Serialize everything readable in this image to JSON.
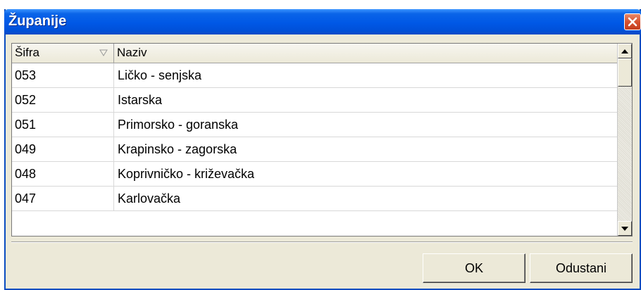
{
  "window": {
    "title": "Županije"
  },
  "grid": {
    "columns": [
      {
        "label": "Šifra"
      },
      {
        "label": "Naziv"
      }
    ],
    "rows": [
      {
        "sifra": "053",
        "naziv": "Ličko - senjska"
      },
      {
        "sifra": "052",
        "naziv": "Istarska"
      },
      {
        "sifra": "051",
        "naziv": "Primorsko - goranska"
      },
      {
        "sifra": "049",
        "naziv": "Krapinsko - zagorska"
      },
      {
        "sifra": "048",
        "naziv": "Koprivničko - križevačka"
      },
      {
        "sifra": "047",
        "naziv": "Karlovačka"
      }
    ]
  },
  "buttons": {
    "ok_label": "OK",
    "cancel_label": "Odustani"
  },
  "icons": {
    "close": "close-icon",
    "sort": "sort-descending-icon",
    "scroll_up": "arrow-up-icon",
    "scroll_down": "arrow-down-icon"
  },
  "colors": {
    "titlebar": "#0058e6",
    "close": "#d7512f",
    "face": "#ece9d8"
  }
}
